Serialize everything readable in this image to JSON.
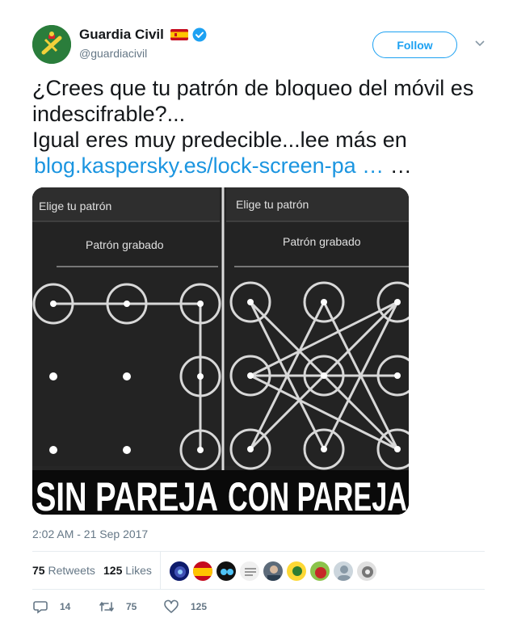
{
  "author": {
    "name": "Guardia Civil",
    "handle": "@guardiacivil",
    "flag_icon": "spain-flag-icon",
    "verified_icon": "verified-badge-icon"
  },
  "follow_label": "Follow",
  "tweet": {
    "line1": "¿Crees que tu patrón de bloqueo del móvil es",
    "line2": "indescifrable?...",
    "line3": "Igual eres muy predecible...lee más en",
    "link": "blog.kaspersky.es/lock-screen-pa …",
    "ellipsis": " …"
  },
  "media": {
    "left_header": "Elige tu patrón",
    "left_sub": "Patrón grabado",
    "right_header": "Elige tu patrón",
    "right_sub": "Patrón grabado",
    "left_caption": "SIN PAREJA",
    "right_caption": "CON PAREJA"
  },
  "timestamp": "2:02 AM - 21 Sep 2017",
  "stats": {
    "retweets_count": "75",
    "retweets_label": "Retweets",
    "likes_count": "125",
    "likes_label": "Likes"
  },
  "actions": {
    "reply_count": "14",
    "retweet_count": "75",
    "like_count": "125"
  },
  "colors": {
    "brand_blue": "#1da1f2",
    "link_blue": "#1b95e0",
    "muted": "#657786"
  }
}
